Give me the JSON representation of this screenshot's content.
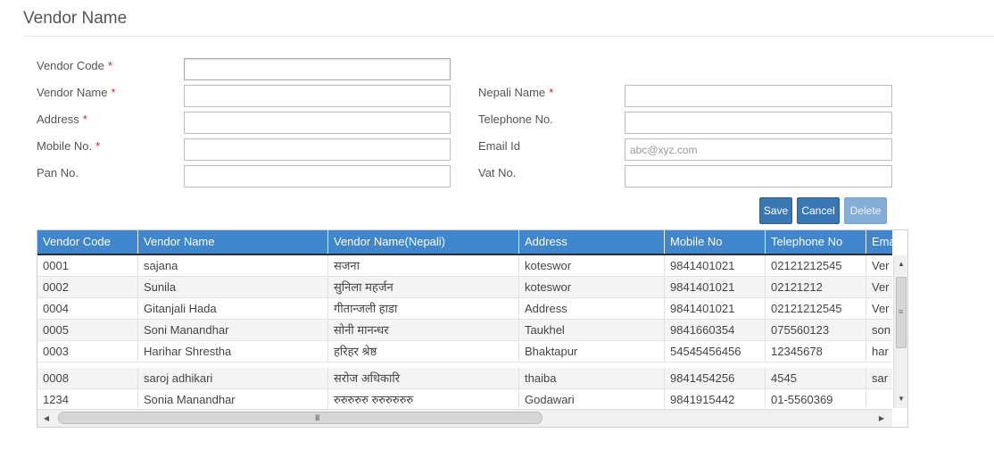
{
  "page": {
    "title": "Vendor Name"
  },
  "form": {
    "vendor_code": {
      "label": "Vendor Code",
      "value": ""
    },
    "vendor_name": {
      "label": "Vendor Name",
      "value": ""
    },
    "nepali_name": {
      "label": "Nepali Name",
      "value": ""
    },
    "address": {
      "label": "Address",
      "value": ""
    },
    "telephone": {
      "label": "Telephone No.",
      "value": ""
    },
    "mobile": {
      "label": "Mobile No.",
      "value": ""
    },
    "email": {
      "label": "Email Id",
      "value": "",
      "placeholder": "abc@xyz.com"
    },
    "pan": {
      "label": "Pan No.",
      "value": ""
    },
    "vat": {
      "label": "Vat No.",
      "value": ""
    },
    "required_mark": "*"
  },
  "buttons": {
    "save": "Save",
    "cancel": "Cancel",
    "delete": "Delete"
  },
  "grid": {
    "columns": [
      "Vendor Code",
      "Vendor Name",
      "Vendor Name(Nepali)",
      "Address",
      "Mobile No",
      "Telephone No",
      "Email"
    ],
    "rows": [
      [
        "0001",
        "sajana",
        "सजना",
        "koteswor",
        "9841401021",
        "02121212545",
        "Ver"
      ],
      [
        "0002",
        "Sunila",
        "सुनिला महर्जन",
        "koteswor",
        "9841401021",
        "02121212",
        "Ver"
      ],
      [
        "0004",
        "Gitanjali Hada",
        "गीतान्जली हाडा",
        "Address",
        "9841401021",
        "02121212545",
        "Ver"
      ],
      [
        "0005",
        "Soni Manandhar",
        "सोनी मानन्धर",
        "Taukhel",
        "9841660354",
        "075560123",
        "son"
      ],
      [
        "0003",
        "Harihar Shrestha",
        "हरिहर श्रेष्ठ",
        "Bhaktapur",
        "54545456456",
        "12345678",
        "har"
      ],
      [
        "0008",
        "saroj adhikari",
        "सरोज अधिकारि",
        "thaiba",
        "9841454256",
        "4545",
        "sar"
      ],
      [
        "1234",
        "Sonia Manandhar",
        "रुरुरुरुरु रुरुरुरुरुरु",
        "Godawari",
        "9841915442",
        "01-5560369",
        ""
      ]
    ]
  }
}
